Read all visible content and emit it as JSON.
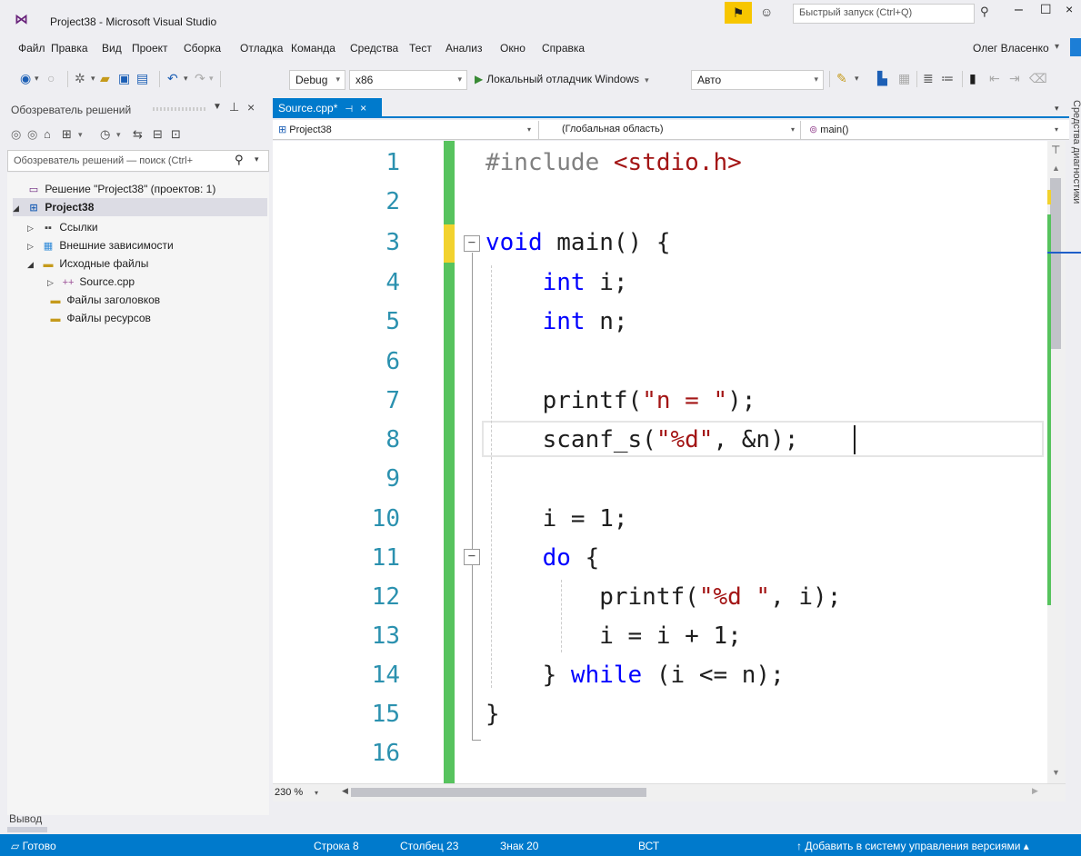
{
  "window": {
    "title": "Project38 - Microsoft Visual Studio",
    "quick_launch_placeholder": "Быстрый запуск (Ctrl+Q)"
  },
  "menu": [
    "Файл",
    "Правка",
    "Вид",
    "Проект",
    "Сборка",
    "Отладка",
    "Команда",
    "Средства",
    "Тест",
    "Анализ",
    "Окно",
    "Справка"
  ],
  "user": {
    "name": "Олег Власенко"
  },
  "toolbar": {
    "configuration": "Debug",
    "platform": "x86",
    "start_debug_label": "Локальный отладчик Windows",
    "auto": "Авто"
  },
  "solution_explorer": {
    "title": "Обозреватель решений",
    "search_placeholder": "Обозреватель решений — поиск (Ctrl+",
    "tree": [
      {
        "label": "Решение \"Project38\" (проектов: 1)",
        "icon": "solution-icon"
      },
      {
        "label": "Project38",
        "icon": "project-icon"
      },
      {
        "label": "Ссылки",
        "icon": "references-icon"
      },
      {
        "label": "Внешние зависимости",
        "icon": "external-deps-icon"
      },
      {
        "label": "Исходные файлы",
        "icon": "folder-icon"
      },
      {
        "label": "Source.cpp",
        "icon": "cpp-file-icon"
      },
      {
        "label": "Файлы заголовков",
        "icon": "folder-icon"
      },
      {
        "label": "Файлы ресурсов",
        "icon": "folder-icon"
      }
    ]
  },
  "editor": {
    "tab_label": "Source.cpp*",
    "nav_project": "Project38",
    "nav_scope": "(Глобальная область)",
    "nav_member": "main()",
    "zoom": "230 %",
    "line_numbers": [
      "1",
      "2",
      "3",
      "4",
      "5",
      "6",
      "7",
      "8",
      "9",
      "10",
      "11",
      "12",
      "13",
      "14",
      "15",
      "16"
    ]
  },
  "side_panel": {
    "label": "Средства диагностики"
  },
  "output": {
    "label": "Вывод"
  },
  "status": {
    "ready": "Готово",
    "line": "Строка 8",
    "column": "Столбец 23",
    "char": "Знак 20",
    "mode": "ВСТ",
    "source_control": "Добавить в систему управления версиями"
  },
  "colors": {
    "accent": "#007acc",
    "keyword": "#0000ff",
    "string": "#a31515",
    "line_number": "#2b91af",
    "changed_saved": "#57c35e",
    "changed_unsaved": "#f2d22e"
  }
}
